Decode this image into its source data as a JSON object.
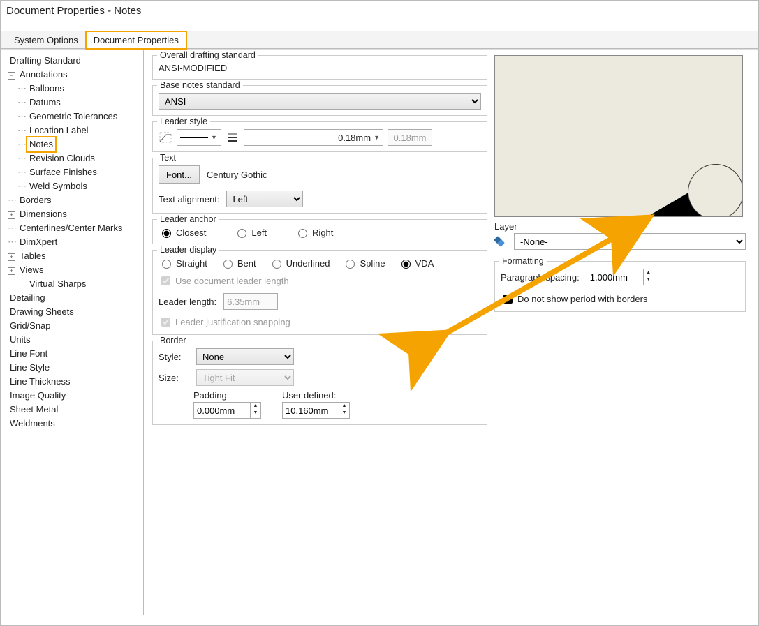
{
  "window_title": "Document Properties - Notes",
  "tabs": {
    "system_options": "System Options",
    "document_properties": "Document Properties"
  },
  "tree": {
    "drafting_standard": "Drafting Standard",
    "annotations": "Annotations",
    "balloons": "Balloons",
    "datums": "Datums",
    "geo_tol": "Geometric Tolerances",
    "location_label": "Location Label",
    "notes": "Notes",
    "revision_clouds": "Revision Clouds",
    "surface_finishes": "Surface Finishes",
    "weld_symbols": "Weld Symbols",
    "borders": "Borders",
    "dimensions": "Dimensions",
    "centerlines": "Centerlines/Center Marks",
    "dimxpert": "DimXpert",
    "tables": "Tables",
    "views": "Views",
    "virtual_sharps": "Virtual Sharps",
    "detailing": "Detailing",
    "drawing_sheets": "Drawing Sheets",
    "grid_snap": "Grid/Snap",
    "units": "Units",
    "line_font": "Line Font",
    "line_style": "Line Style",
    "line_thickness": "Line Thickness",
    "image_quality": "Image Quality",
    "sheet_metal": "Sheet Metal",
    "weldments": "Weldments"
  },
  "overall": {
    "legend": "Overall drafting standard",
    "value": "ANSI-MODIFIED"
  },
  "base_notes": {
    "legend": "Base notes standard",
    "value": "ANSI"
  },
  "leader_style": {
    "legend": "Leader style",
    "thickness_sel": "0.18mm",
    "thickness_txt": "0.18mm"
  },
  "text": {
    "legend": "Text",
    "font_btn": "Font...",
    "font_name": "Century Gothic",
    "align_label": "Text alignment:",
    "align_value": "Left"
  },
  "leader_anchor": {
    "legend": "Leader anchor",
    "closest": "Closest",
    "left": "Left",
    "right": "Right"
  },
  "leader_display": {
    "legend": "Leader display",
    "straight": "Straight",
    "bent": "Bent",
    "underlined": "Underlined",
    "spline": "Spline",
    "vda": "VDA",
    "use_doc_len": "Use document leader length",
    "len_label": "Leader length:",
    "len_value": "6.35mm",
    "justify_snap": "Leader justification snapping"
  },
  "border": {
    "legend": "Border",
    "style_label": "Style:",
    "style_value": "None",
    "size_label": "Size:",
    "size_value": "Tight Fit",
    "padding_label": "Padding:",
    "padding_value": "0.000mm",
    "userdef_label": "User defined:",
    "userdef_value": "10.160mm"
  },
  "layer": {
    "legend": "Layer",
    "value": "-None-"
  },
  "formatting": {
    "legend": "Formatting",
    "para_spacing_label": "Paragraph spacing:",
    "para_spacing_value": "1.000mm",
    "no_period": "Do not show period with borders"
  }
}
